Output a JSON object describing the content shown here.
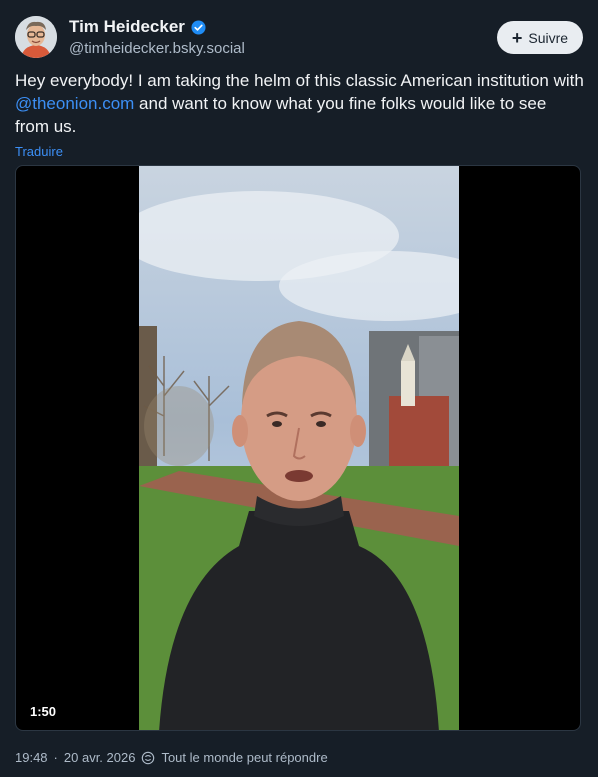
{
  "author": {
    "display_name": "Tim Heidecker",
    "handle": "@timheidecker.bsky.social",
    "verified": true
  },
  "follow_button": {
    "label": "Suivre",
    "icon": "plus-icon"
  },
  "post": {
    "text_before": "Hey everybody! I am taking the helm of this classic American institution with ",
    "mention": "@theonion.com",
    "text_after": " and want to know what you fine folks would like to see from us.",
    "translate_label": "Traduire"
  },
  "video": {
    "duration": "1:50"
  },
  "meta": {
    "time": "19:48",
    "separator": "·",
    "date": "20 avr. 2026",
    "reply_setting": "Tout le monde peut répondre",
    "reply_icon": "reply-settings-icon"
  },
  "colors": {
    "background": "#161e27",
    "accent": "#3c8ff5",
    "muted_text": "#aebbc9"
  }
}
